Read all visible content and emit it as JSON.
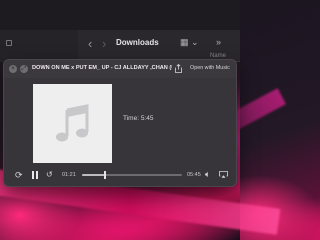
{
  "finder": {
    "title": "Downloads",
    "column_header": "Name",
    "icons": [
      "back-chevron-icon",
      "forward-chevron-icon",
      "grid-view-icon",
      "more-icon"
    ]
  },
  "player": {
    "track_title": "DOWN ON ME x PUT EM_ UP - CJ ALLDAYY ,CHAN (U...",
    "open_with_label": "Open with Music",
    "time_label": "Time: 5:45",
    "elapsed": "01:21",
    "remaining": "05:45",
    "progress_fraction": 0.23,
    "icons": [
      "close-icon",
      "fullscreen-icon",
      "share-icon",
      "music-note-icon",
      "loop-icon",
      "pause-icon",
      "rewind-icon",
      "volume-icon",
      "airplay-icon"
    ]
  },
  "colors": {
    "wallpaper_accent": "#e0146a",
    "panel_background": "#38353a"
  }
}
